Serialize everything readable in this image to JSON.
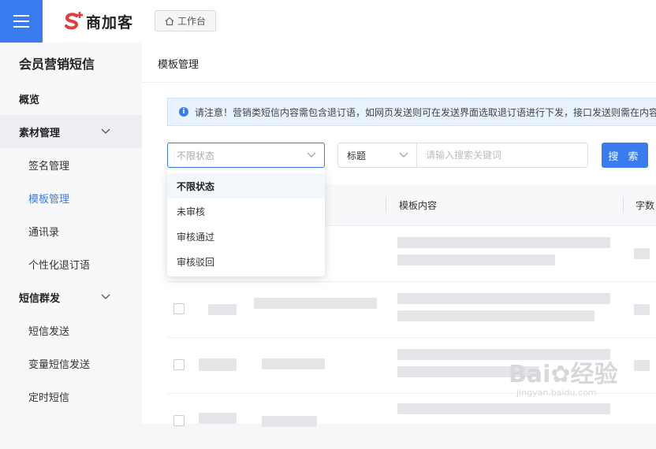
{
  "header": {
    "brand_name": "商加客",
    "workbench_label": "工作台"
  },
  "sidebar": {
    "title": "会员营销短信",
    "items": [
      {
        "label": "概览"
      },
      {
        "label": "素材管理"
      },
      {
        "label": "签名管理"
      },
      {
        "label": "模板管理"
      },
      {
        "label": "通讯录"
      },
      {
        "label": "个性化退订语"
      },
      {
        "label": "短信群发"
      },
      {
        "label": "短信发送"
      },
      {
        "label": "变量短信发送"
      },
      {
        "label": "定时短信"
      }
    ]
  },
  "main": {
    "page_title": "模板管理",
    "notice": "请注意！营销类短信内容需包含退订语，如网页发送则可在发送界面选取退订语进行下发，接口发送则需在内容",
    "filters": {
      "status_value": "不限状态",
      "field_value": "标题",
      "search_placeholder": "请输入搜索关键词",
      "search_button": "搜 索"
    },
    "table": {
      "columns": [
        "模板内容",
        "字数"
      ]
    },
    "status_dropdown": {
      "options": [
        "不限状态",
        "未审核",
        "审核通过",
        "审核驳回"
      ]
    }
  },
  "watermark": {
    "text": "Bai",
    "text2": "经验",
    "url": "jingyan.baidu.com"
  },
  "colors": {
    "accent": "#3a7bf0",
    "brand_red": "#e33b3b"
  }
}
